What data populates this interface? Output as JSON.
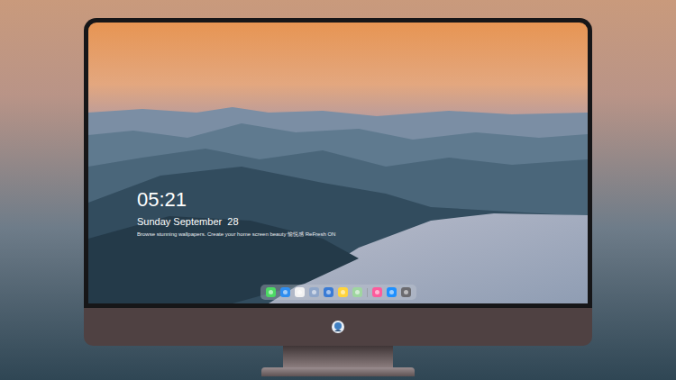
{
  "lock_screen": {
    "time": "05:21",
    "date": "Sunday September  28",
    "caption": "Browse stunning wallpapers. Create your home screen beauty 愉悦感 ReFresh ON"
  },
  "dock": {
    "items": [
      {
        "kind": "app",
        "color": "#4cd964"
      },
      {
        "kind": "app",
        "color": "#2f8ef0"
      },
      {
        "kind": "app",
        "color": "#f2f2f2"
      },
      {
        "kind": "app",
        "color": "#8fa6c9"
      },
      {
        "kind": "app",
        "color": "#3a7bd5"
      },
      {
        "kind": "app",
        "color": "#ffd43b"
      },
      {
        "kind": "app",
        "color": "#9fd6a0"
      },
      {
        "kind": "separator",
        "color": "#9aa0a8"
      },
      {
        "kind": "app",
        "color": "#fc5c9c"
      },
      {
        "kind": "app",
        "color": "#1e90ff"
      },
      {
        "kind": "app",
        "color": "#6b6b6f"
      }
    ]
  }
}
